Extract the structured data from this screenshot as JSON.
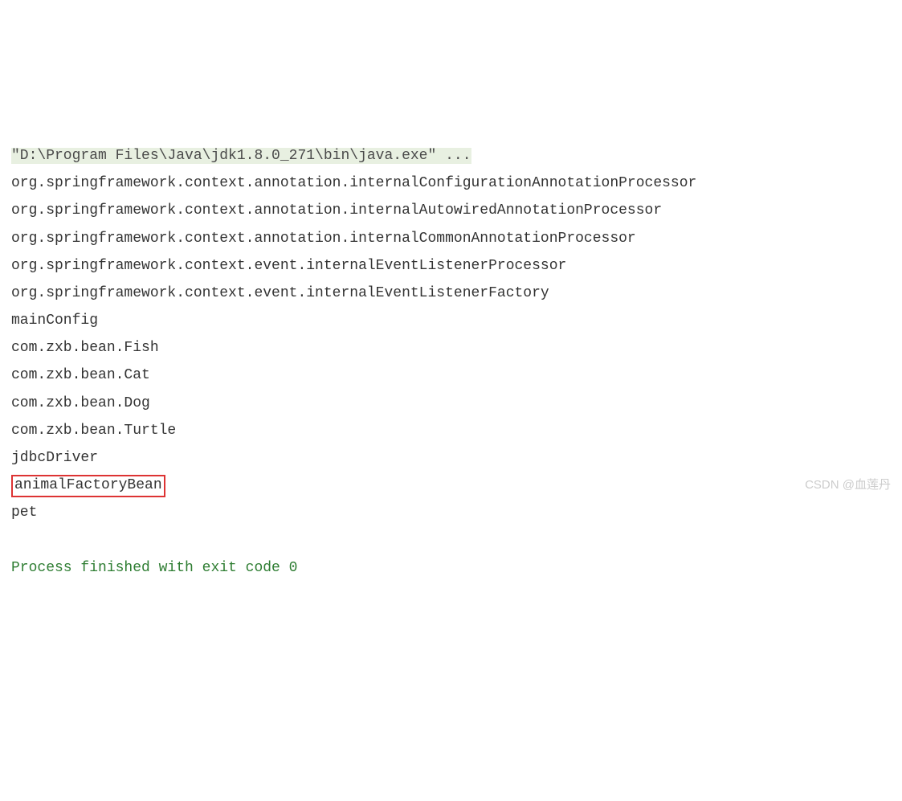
{
  "console": {
    "command": "\"D:\\Program Files\\Java\\jdk1.8.0_271\\bin\\java.exe\" ...",
    "lines": [
      "org.springframework.context.annotation.internalConfigurationAnnotationProcessor",
      "org.springframework.context.annotation.internalAutowiredAnnotationProcessor",
      "org.springframework.context.annotation.internalCommonAnnotationProcessor",
      "org.springframework.context.event.internalEventListenerProcessor",
      "org.springframework.context.event.internalEventListenerFactory",
      "mainConfig",
      "com.zxb.bean.Fish",
      "com.zxb.bean.Cat",
      "com.zxb.bean.Dog",
      "com.zxb.bean.Turtle",
      "jdbcDriver"
    ],
    "highlighted_line": "animalFactoryBean",
    "after_highlight": [
      "pet"
    ],
    "exit_message": "Process finished with exit code 0"
  },
  "watermark": "CSDN @血莲丹"
}
